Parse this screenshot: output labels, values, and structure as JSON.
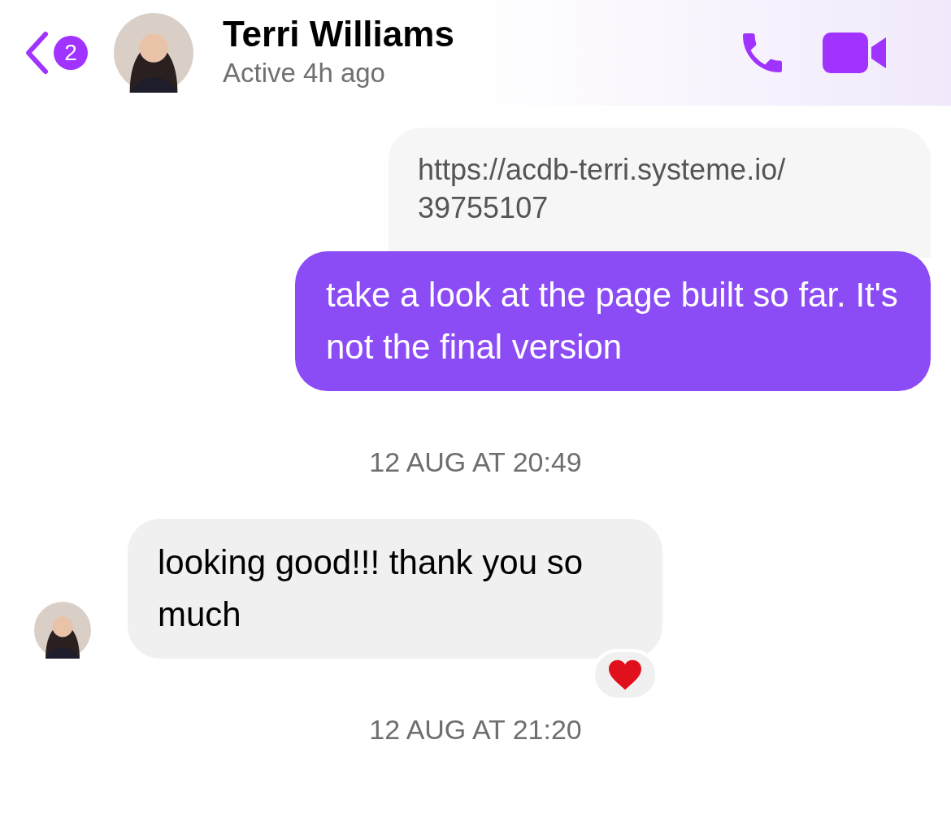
{
  "header": {
    "unread_count": "2",
    "name": "Terri Williams",
    "status": "Active 4h ago"
  },
  "messages": [
    {
      "kind": "reply_preview",
      "text": "https://acdb-terri.systeme.io/ 39755107"
    },
    {
      "kind": "sent",
      "text": "take a look at the page built so far. It's not the final version"
    },
    {
      "kind": "timestamp",
      "text": "12 AUG AT 20:49"
    },
    {
      "kind": "received",
      "text": "looking good!!! thank you so much",
      "reacted": true
    },
    {
      "kind": "timestamp",
      "text": "12 AUG AT 21:20"
    }
  ]
}
